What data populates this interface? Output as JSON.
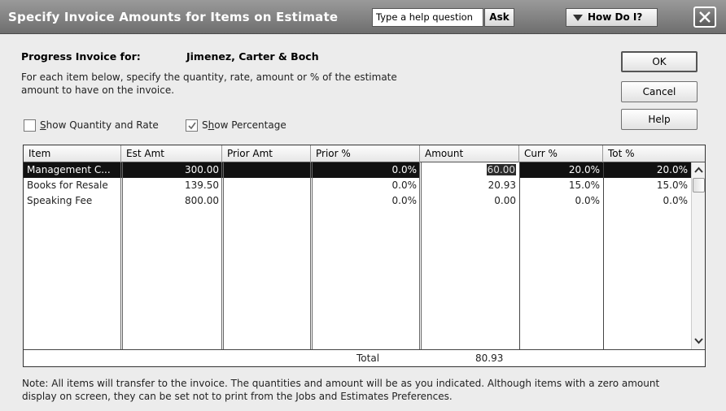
{
  "window": {
    "title": "Specify Invoice Amounts for Items on Estimate",
    "help_placeholder": "Type a help question",
    "ask_label": "Ask",
    "howdoi_label": "How Do I?"
  },
  "header": {
    "progress_label": "Progress Invoice for:",
    "customer": "Jimenez, Carter & Boch",
    "instructions_line1": "For each item below, specify the quantity, rate, amount or % of the estimate",
    "instructions_line2": "amount to have on the invoice."
  },
  "options": {
    "show_qty_rate": {
      "label_pre": "",
      "label_u": "S",
      "label_post": "how Quantity and Rate",
      "checked": false
    },
    "show_percentage": {
      "label_pre": "S",
      "label_u": "h",
      "label_post": "ow Percentage",
      "checked": true
    }
  },
  "buttons": {
    "ok": "OK",
    "cancel": "Cancel",
    "help": "Help"
  },
  "table": {
    "columns": [
      "Item",
      "Est Amt",
      "Prior Amt",
      "Prior %",
      "Amount",
      "Curr %",
      "Tot %"
    ],
    "rows": [
      {
        "item": "Management C...",
        "est_amt": "300.00",
        "prior_amt": "",
        "prior_pct": "0.0%",
        "amount": "60.00",
        "curr_pct": "20.0%",
        "tot_pct": "20.0%"
      },
      {
        "item": "Books for Resale",
        "est_amt": "139.50",
        "prior_amt": "",
        "prior_pct": "0.0%",
        "amount": "20.93",
        "curr_pct": "15.0%",
        "tot_pct": "15.0%"
      },
      {
        "item": "Speaking Fee",
        "est_amt": "800.00",
        "prior_amt": "",
        "prior_pct": "0.0%",
        "amount": "0.00",
        "curr_pct": "0.0%",
        "tot_pct": "0.0%"
      }
    ],
    "total_label": "Total",
    "total_amount": "80.93"
  },
  "note": {
    "line1": "Note: All items will transfer to the invoice. The quantities and amount will be as you indicated. Although items with a zero amount",
    "line2": "display on screen, they can be set not to print from the Jobs and Estimates Preferences."
  }
}
